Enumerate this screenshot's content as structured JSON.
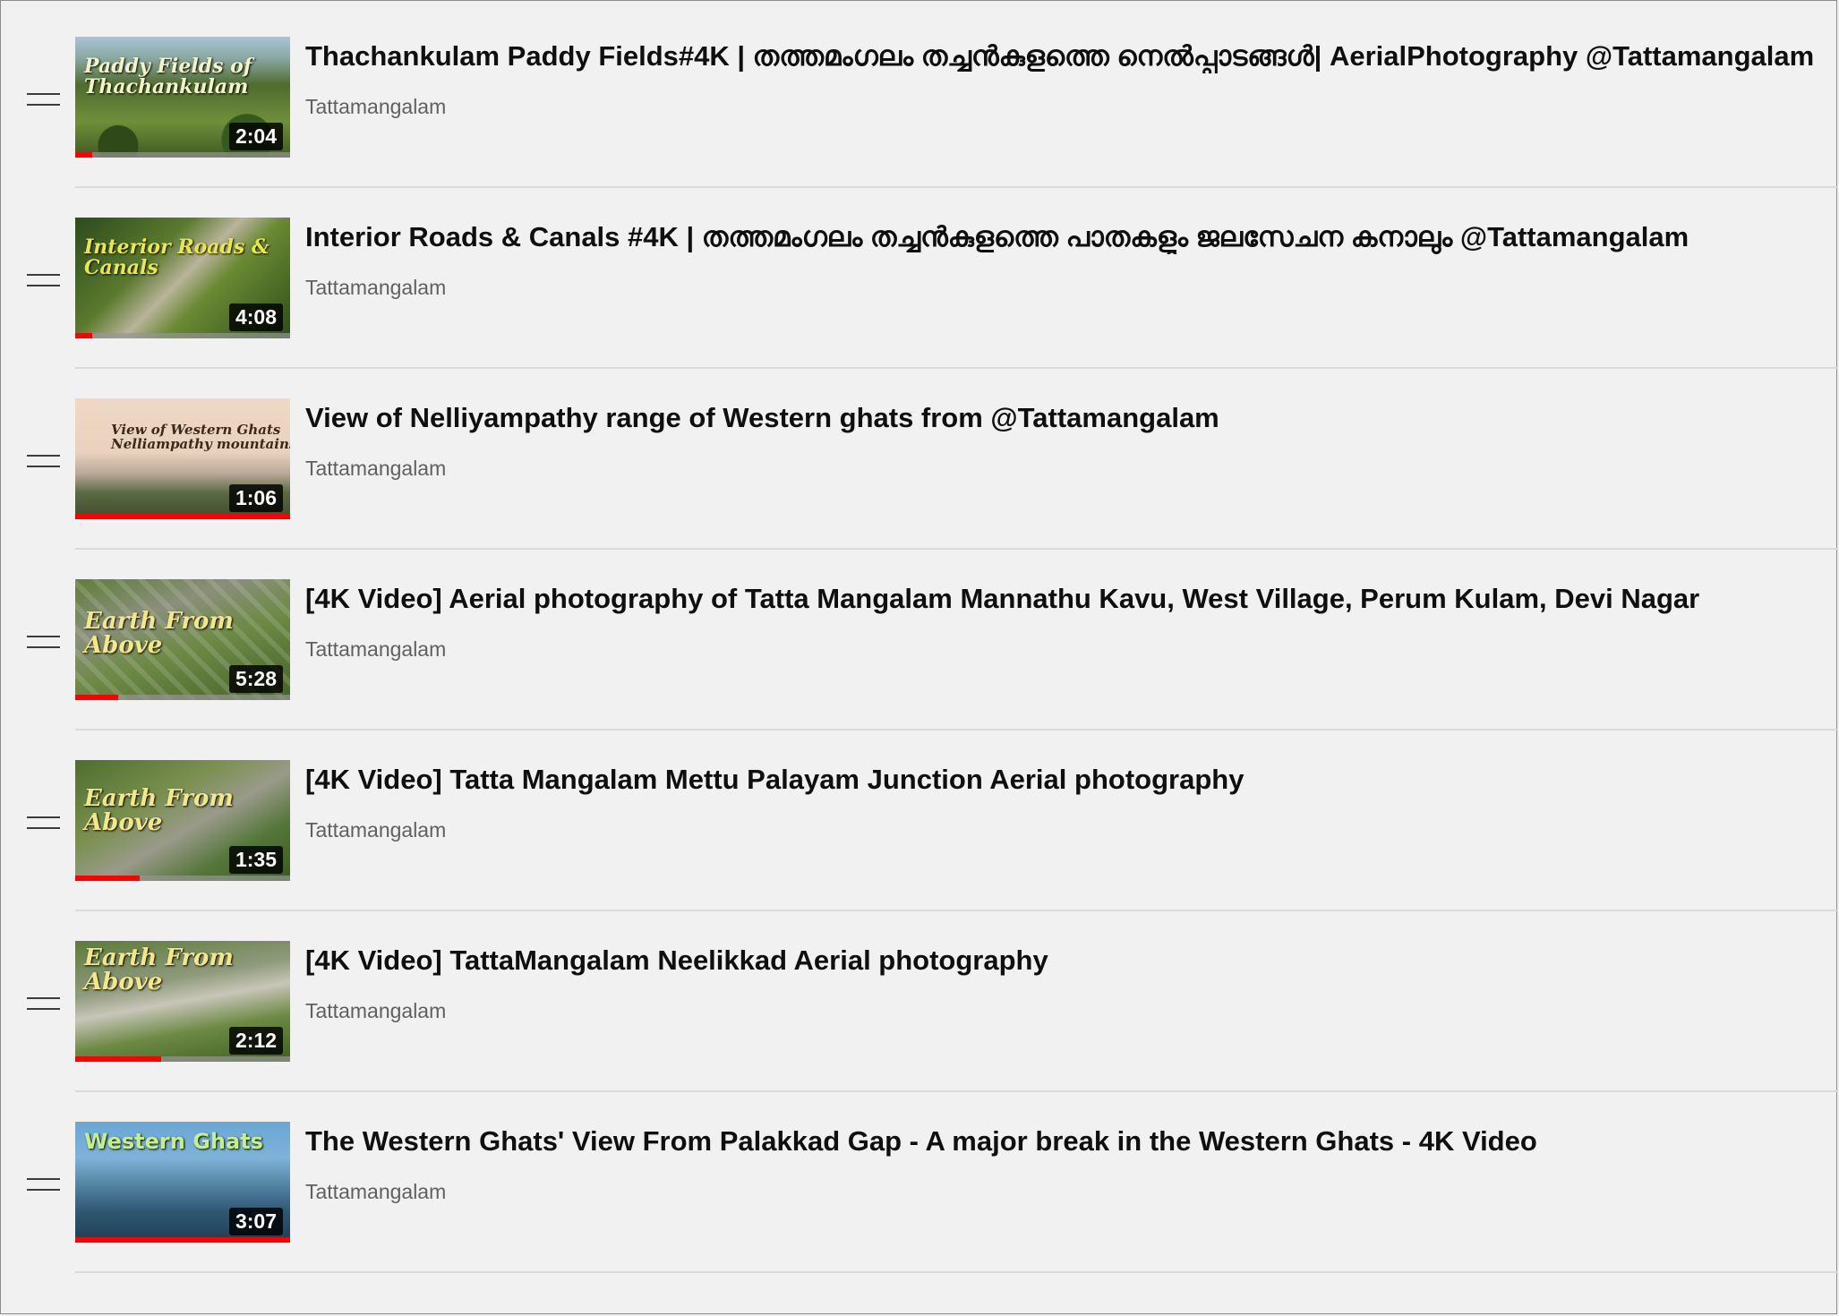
{
  "playlist": {
    "items": [
      {
        "title": "Thachankulam Paddy Fields#4K | തത്തമംഗലം തച്ചൻകുളത്തെ നെൽപ്പാടങ്ങൾ| AerialPhotography @Tattamangalam",
        "channel": "Tattamangalam",
        "duration": "2:04",
        "thumb_caption": "Paddy Fields of Thachankulam",
        "watched_fraction": 0.08
      },
      {
        "title": "Interior Roads & Canals #4K | തത്തമംഗലം തച്ചൻകുളത്തെ പാതകളും ജലസേചന കനാലും @Tattamangalam",
        "channel": "Tattamangalam",
        "duration": "4:08",
        "thumb_caption": "Interior Roads & Canals",
        "watched_fraction": 0.08
      },
      {
        "title": "View of Nelliyampathy range of Western ghats from @Tattamangalam",
        "channel": "Tattamangalam",
        "duration": "1:06",
        "thumb_caption": "View of Western Ghats Nelliampathy mountains",
        "watched_fraction": 1.0
      },
      {
        "title": "[4K Video] Aerial photography of Tatta Mangalam Mannathu Kavu, West Village, Perum Kulam, Devi Nagar",
        "channel": "Tattamangalam",
        "duration": "5:28",
        "thumb_caption": "Earth From Above",
        "watched_fraction": 0.2
      },
      {
        "title": "[4K Video] Tatta Mangalam Mettu Palayam Junction Aerial photography",
        "channel": "Tattamangalam",
        "duration": "1:35",
        "thumb_caption": "Earth From Above",
        "watched_fraction": 0.3
      },
      {
        "title": "[4K Video] TattaMangalam Neelikkad Aerial photography",
        "channel": "Tattamangalam",
        "duration": "2:12",
        "thumb_caption": "Earth From Above",
        "watched_fraction": 0.4
      },
      {
        "title": "The Western Ghats' View From Palakkad Gap - A major break in the Western Ghats - 4K Video",
        "channel": "Tattamangalam",
        "duration": "3:07",
        "thumb_caption": "Western Ghats",
        "watched_fraction": 1.0
      }
    ]
  },
  "icons": {
    "drag_handle": "drag-handle-icon"
  },
  "colors": {
    "background": "#f1f1f1",
    "title_text": "#0f0f0f",
    "channel_text": "#606060",
    "progress": "#ff0000",
    "divider": "#dadada"
  }
}
